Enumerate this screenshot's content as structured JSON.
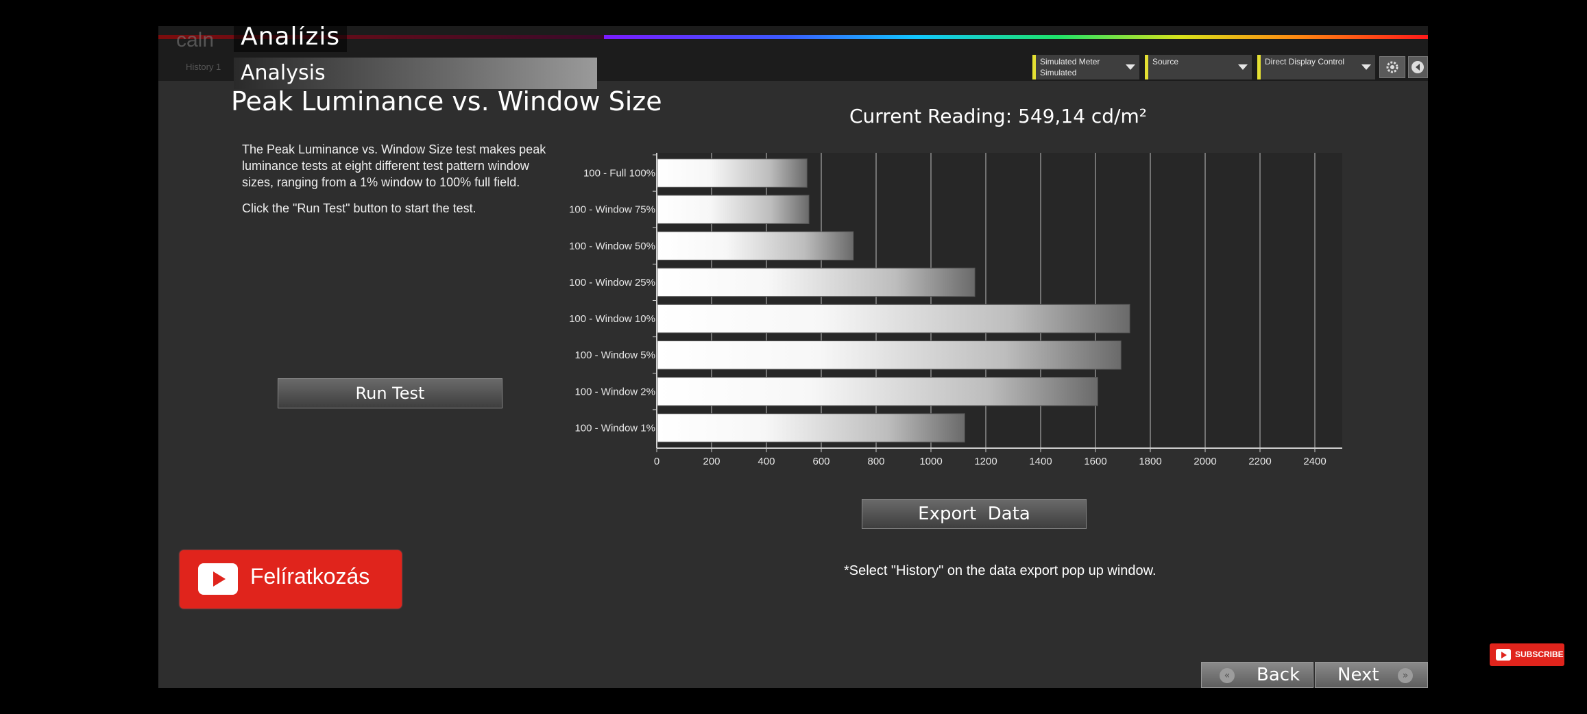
{
  "header": {
    "title_hu": "Analízis",
    "title_en": "Analysis",
    "logo_text": "caln",
    "history_tab": "History 1"
  },
  "toolbar": {
    "meter_label": "Simulated Meter",
    "meter_value": "Simulated",
    "source_label": "Source",
    "display_label": "Direct Display Control"
  },
  "main": {
    "page_title": "Peak Luminance vs. Window Size",
    "description_1": "The Peak Luminance vs. Window Size test makes peak luminance tests at eight different test pattern window sizes, ranging from a 1% window to 100% full field.",
    "description_2": "Click the \"Run Test\" button to start the test.",
    "run_test_label": "Run Test",
    "current_reading": "Current Reading: 549,14 cd/m²",
    "export_label": "Export  Data",
    "export_note": "*Select \"History\" on the data export pop up window."
  },
  "nav": {
    "back_label": "Back",
    "next_label": "Next"
  },
  "overlay": {
    "subscribe_big": "Felíratkozás",
    "subscribe_small": "SUBSCRIBE"
  },
  "colors": {
    "app_bg": "#2e2e2e",
    "chart_bg": "#272727",
    "accent_yellow": "#e4e033",
    "youtube_red": "#e0241c"
  },
  "chart_data": {
    "type": "bar",
    "orientation": "horizontal",
    "categories": [
      "100 - Full  100%",
      "100 - Window 75%",
      "100 - Window 50%",
      "100 - Window 25%",
      "100 - Window 10%",
      "100 - Window  5%",
      "100 - Window  2%",
      "100 - Window  1%"
    ],
    "values": [
      548,
      555,
      717,
      1160,
      1725,
      1693,
      1608,
      1123
    ],
    "xlim": [
      0,
      2500
    ],
    "xticks": [
      0,
      200,
      400,
      600,
      800,
      1000,
      1200,
      1400,
      1600,
      1800,
      2000,
      2200,
      2400
    ],
    "grid": true,
    "legend": "none"
  }
}
